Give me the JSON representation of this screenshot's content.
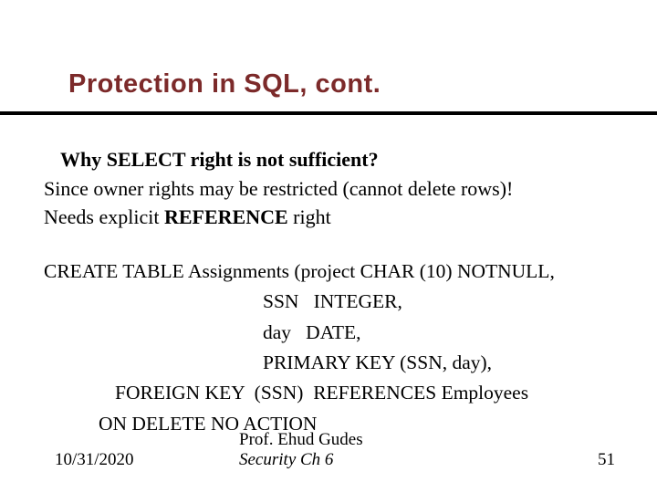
{
  "title": "Protection in SQL, cont.",
  "question": "Why SELECT right is not sufficient?",
  "line1": "Since owner rights may be restricted (cannot delete rows)!",
  "line2_pre": "Needs explicit ",
  "line2_bold": "REFERENCE",
  "line2_post": " right",
  "code": {
    "l1": "CREATE TABLE Assignments (project CHAR (10) NOTNULL,",
    "l2": "SSN   INTEGER,",
    "l3": "day   DATE,",
    "l4": "PRIMARY KEY (SSN, day),",
    "l5": "FOREIGN KEY  (SSN)  REFERENCES Employees",
    "l6": "ON DELETE NO ACTION"
  },
  "footer": {
    "author": "Prof. Ehud Gudes",
    "course": "Security  Ch 6",
    "date": "10/31/2020",
    "page": "51"
  }
}
